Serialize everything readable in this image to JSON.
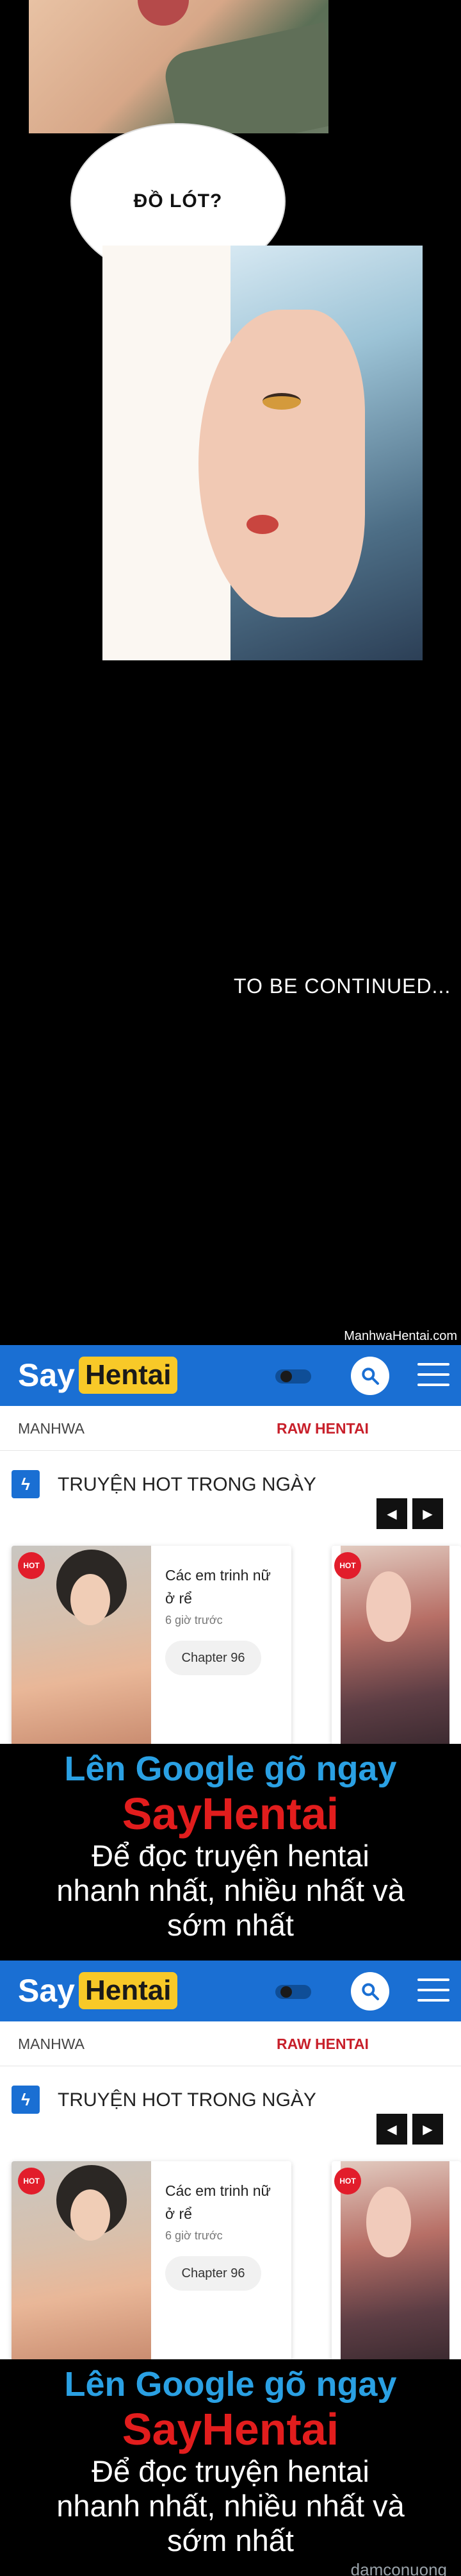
{
  "comic": {
    "speech_bubble": "ĐỒ LÓT?",
    "to_be_continued": "TO BE CONTINUED...",
    "watermark": "ManhwaHentai.com"
  },
  "ads": [
    {
      "header": {
        "logo_say": "Say",
        "logo_hentai": "Hentai"
      },
      "nav": {
        "manhwa": "MANHWA",
        "raw": "RAW HENTAI"
      },
      "hot": {
        "title": "TRUYỆN HOT TRONG NGÀY",
        "card": {
          "title": "Các em trinh nữ ở rể",
          "time": "6 giờ trước",
          "chapter": "Chapter 96"
        },
        "badge": "HOT"
      },
      "promo": {
        "line1": "Lên Google gõ ngay",
        "line2": "SayHentai",
        "line3a": "Để đọc truyện hentai",
        "line3b": "nhanh nhất, nhiều nhất và",
        "line3c": "sớm nhất"
      }
    },
    {
      "header": {
        "logo_say": "Say",
        "logo_hentai": "Hentai"
      },
      "nav": {
        "manhwa": "MANHWA",
        "raw": "RAW HENTAI"
      },
      "hot": {
        "title": "TRUYỆN HOT TRONG NGÀY",
        "card": {
          "title": "Các em trinh nữ ở rể",
          "time": "6 giờ trước",
          "chapter": "Chapter 96"
        },
        "badge": "HOT"
      },
      "promo": {
        "line1": "Lên Google gõ ngay",
        "line2": "SayHentai",
        "line3a": "Để đọc truyện hentai",
        "line3b": "nhanh nhất, nhiều nhất và",
        "line3c": "sớm nhất"
      }
    }
  ],
  "footer_watermark": "damconuong",
  "colors": {
    "brand_blue": "#1a6fd3",
    "logo_yellow": "#f8c928",
    "raw_red": "#c8202b",
    "promo_blue": "#2aa0e3",
    "promo_red": "#e21d1d"
  }
}
